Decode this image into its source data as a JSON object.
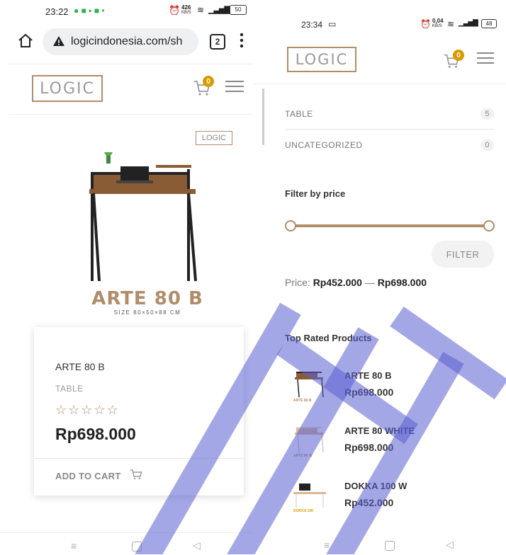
{
  "left": {
    "status": {
      "time": "23:22",
      "net": "426",
      "net_unit": "KB/S",
      "battery": "50"
    },
    "browser": {
      "url": "logicindonesia.com/sh",
      "tab_count": "2"
    },
    "header": {
      "logo": "LOGIC",
      "cart_count": "0"
    },
    "product": {
      "image_logo": "LOGIC",
      "image_title": "ARTE 80 B",
      "image_size": "SIZE 80×50×88 CM",
      "name": "ARTE 80 B",
      "category": "TABLE",
      "stars": "☆☆☆☆☆",
      "price": "Rp698.000",
      "add_to_cart": "ADD TO CART"
    }
  },
  "right": {
    "status": {
      "time": "23:34",
      "net": "0,04",
      "net_unit": "KB/S",
      "battery": "48"
    },
    "header": {
      "logo": "LOGIC",
      "cart_count": "0"
    },
    "categories": [
      {
        "label": "TABLE",
        "count": "5"
      },
      {
        "label": "UNCATEGORIZED",
        "count": "0"
      }
    ],
    "filter": {
      "heading": "Filter by price",
      "button": "FILTER",
      "price_label": "Price:",
      "min": "Rp452.000",
      "sep": "—",
      "max": "Rp698.000"
    },
    "top_rated": {
      "heading": "Top Rated Products",
      "items": [
        {
          "name": "ARTE 80 B",
          "price": "Rp698.000",
          "thumb": "ARTE 80 B"
        },
        {
          "name": "ARTE 80 WHITE",
          "price": "Rp698.000",
          "thumb": "ARTE 80 W"
        },
        {
          "name": "DOKKA 100 W",
          "price": "Rp452.000",
          "thumb": "DOKKA 100"
        }
      ]
    }
  },
  "colors": {
    "accent_brown": "#b08d6a",
    "badge_gold": "#d99a00",
    "watermark_blue": "#5a5fd0"
  }
}
